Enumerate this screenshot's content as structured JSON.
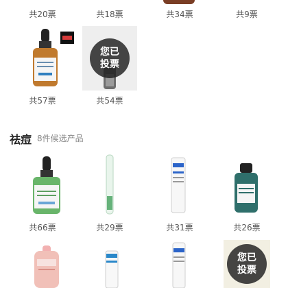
{
  "top_row_votes": [
    "共20票",
    "共18票",
    "共34票",
    "共9票"
  ],
  "row2": {
    "votes": [
      "共57票",
      "共54票"
    ],
    "voted_overlay": {
      "line1": "您已",
      "line2": "投票"
    }
  },
  "section": {
    "title": "祛痘",
    "subtitle": "8件候选产品"
  },
  "row3": {
    "votes": [
      "共66票",
      "共29票",
      "共31票",
      "共26票"
    ]
  },
  "row4": {
    "voted_overlay": {
      "line1": "您已",
      "line2": "投票"
    }
  },
  "icons": {
    "product-image": "product-photo",
    "voted-badge": "dark-circle"
  },
  "colors": {
    "vote_text": "#555555",
    "section_title": "#222222",
    "section_sub": "#888888",
    "overlay": "#1e1e1e"
  }
}
